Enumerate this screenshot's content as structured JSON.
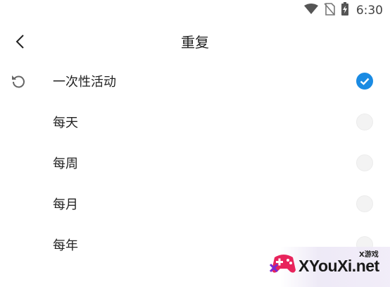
{
  "status_bar": {
    "time": "6:30",
    "icons": [
      "wifi-icon",
      "no-sim-icon",
      "battery-charging-icon"
    ]
  },
  "header": {
    "title": "重复",
    "back_icon": "chevron-left-icon"
  },
  "options": [
    {
      "label": "一次性活动",
      "selected": true,
      "leading_icon": "reset-icon"
    },
    {
      "label": "每天",
      "selected": false
    },
    {
      "label": "每周",
      "selected": false
    },
    {
      "label": "每月",
      "selected": false
    },
    {
      "label": "每年",
      "selected": false
    }
  ],
  "watermark": {
    "small_text": "X游戏",
    "big_text": "XYouXi.net",
    "logo_icon": "gamepad-icon"
  },
  "colors": {
    "accent": "#1a8be3",
    "unselected_radio": "#f3f3f3",
    "text": "#222222"
  }
}
